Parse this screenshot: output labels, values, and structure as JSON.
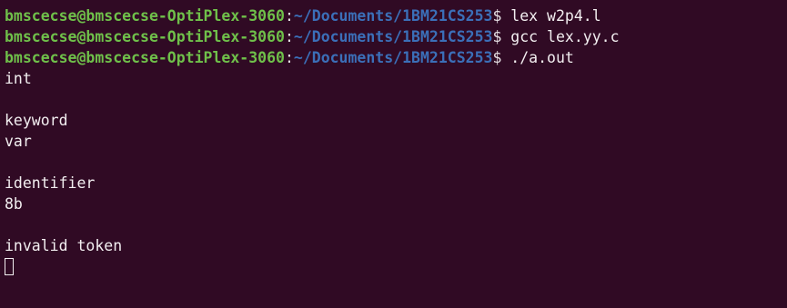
{
  "terminal": {
    "prompt_user_host": "bmscecse@bmscecse-OptiPlex-3060",
    "prompt_sep": ":",
    "prompt_path": "~/Documents/1BM21CS253",
    "prompt_dollar": "$",
    "commands": [
      " lex w2p4.l",
      " gcc lex.yy.c",
      " ./a.out"
    ],
    "output": [
      "int",
      "",
      "keyword",
      "var",
      "",
      "identifier",
      "8b",
      "",
      "invalid token"
    ]
  },
  "colors": {
    "background": "#300a24",
    "prompt_user": "#6fc04a",
    "prompt_path": "#3b6fb8",
    "text": "#f2eef0"
  }
}
